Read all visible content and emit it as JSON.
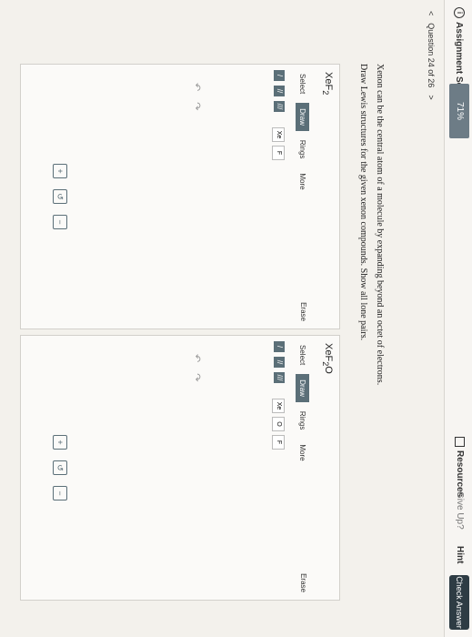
{
  "header": {
    "score_label": "Assignment Score:",
    "score_value": "71%",
    "resources": "Resources",
    "give_up": "Give Up?",
    "hint": "Hint",
    "check_answer": "Check Answer"
  },
  "nav": {
    "prev": "<",
    "label": "Question 24 of 26",
    "next": ">"
  },
  "prompt": {
    "line1": "Xenon can be the central atom of a molecule by expanding beyond an octet of electrons.",
    "line2": "Draw Lewis structures for the given xenon compounds. Show all lone pairs."
  },
  "left": {
    "formula": "XeF2",
    "tools": [
      "Select",
      "Draw",
      "Rings",
      "More"
    ],
    "erase": "Erase",
    "bonds": [
      "/",
      "//",
      "///"
    ],
    "atoms": [
      "Xe",
      "F"
    ]
  },
  "right": {
    "formula": "XeF2O",
    "tools": [
      "Select",
      "Draw",
      "Rings",
      "More"
    ],
    "erase": "Erase",
    "bonds": [
      "/",
      "//",
      "///"
    ],
    "atoms": [
      "Xe",
      "O",
      "F"
    ]
  }
}
